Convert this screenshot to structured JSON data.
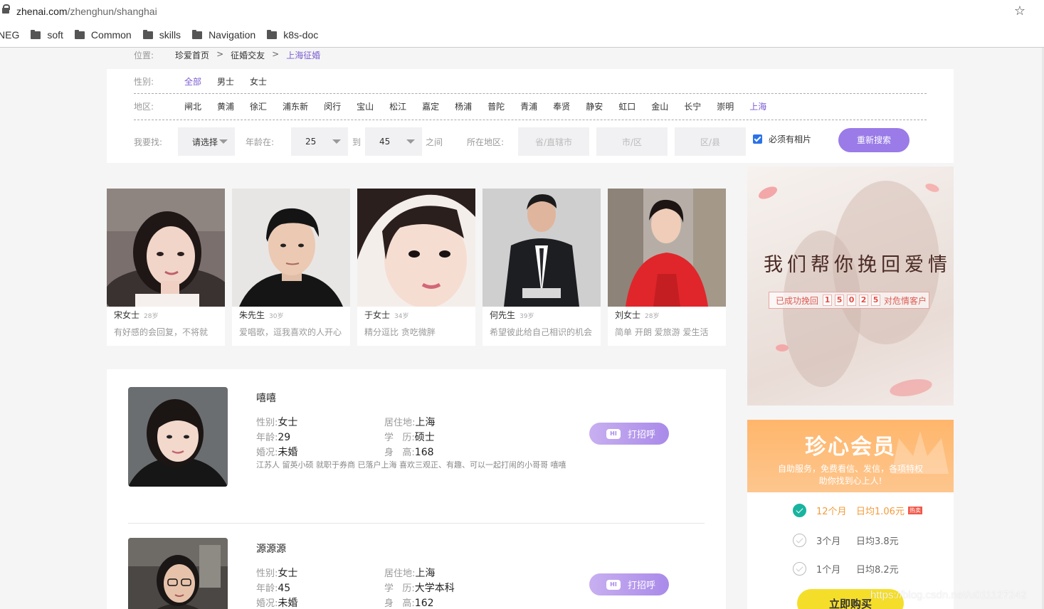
{
  "browser": {
    "url_domain": "zhenai.com",
    "url_path": "/zhenghun/shanghai",
    "bookmarks": [
      "NEG",
      "soft",
      "Common",
      "skills",
      "Navigation",
      "k8s-doc"
    ]
  },
  "breadcrumb": {
    "label": "位置:",
    "items": [
      "珍爱首页",
      ">",
      "征婚交友",
      ">",
      "上海征婚"
    ]
  },
  "filter": {
    "gender_label": "性别:",
    "gender_options": [
      "全部",
      "男士",
      "女士"
    ],
    "region_label": "地区:",
    "region_options": [
      "闸北",
      "黄浦",
      "徐汇",
      "浦东新",
      "闵行",
      "宝山",
      "松江",
      "嘉定",
      "杨浦",
      "普陀",
      "青浦",
      "奉贤",
      "静安",
      "虹口",
      "金山",
      "长宁",
      "崇明",
      "上海"
    ],
    "seek_label": "我要找:",
    "seek_value": "请选择",
    "age_label": "年龄在:",
    "age_from": "25",
    "age_to_label": "到",
    "age_to": "45",
    "age_between": "之间",
    "location_label": "所在地区:",
    "province_placeholder": "省/直辖市",
    "city_placeholder": "市/区",
    "district_placeholder": "区/县",
    "photo_required_label": "必须有相片",
    "search_button": "重新搜索"
  },
  "recommended": [
    {
      "name": "宋女士",
      "age": "28岁",
      "desc": "有好感的会回复，不将就"
    },
    {
      "name": "朱先生",
      "age": "30岁",
      "desc": "爱唱歌，逗我喜欢的人开心"
    },
    {
      "name": "于女士",
      "age": "34岁",
      "desc": "精分逗比 贪吃微胖"
    },
    {
      "name": "何先生",
      "age": "39岁",
      "desc": "希望彼此给自己相识的机会"
    },
    {
      "name": "刘女士",
      "age": "28岁",
      "desc": "简单 开朗 爱旅游 爱生活"
    }
  ],
  "banner": {
    "title": "我们帮你挽回爱情",
    "counter_prefix": "已成功挽回",
    "digits": [
      "1",
      "5",
      "0",
      "2",
      "5"
    ],
    "counter_suffix": "对危情客户"
  },
  "vip": {
    "title": "珍心会员",
    "subtitle_line1": "自助服务，免费看信、发信，各项特权",
    "subtitle_line2": "助你找到心上人!",
    "plans": [
      {
        "duration": "12个月",
        "price": "日均1.06元",
        "badge": "热卖",
        "selected": true
      },
      {
        "duration": "3个月",
        "price": "日均3.8元",
        "badge": "",
        "selected": false
      },
      {
        "duration": "1个月",
        "price": "日均8.2元",
        "badge": "",
        "selected": false
      }
    ],
    "buy_button": "立即购买"
  },
  "members": [
    {
      "name": "嘻嘻",
      "gender_k": "性别:",
      "gender": "女士",
      "age_k": "年龄:",
      "age": "29",
      "marriage_k": "婚况:",
      "marriage": "未婚",
      "residence_k": "居住地:",
      "residence": "上海",
      "education_k": "学   历:",
      "education": "硕士",
      "height_k": "身   高:",
      "height": "168",
      "bio": "江苏人 留英小硕 就职于券商 已落户上海 喜欢三观正、有趣、可以一起打闹的小哥哥 嘻嘻",
      "hi_button": "打招呼"
    },
    {
      "name": "源源源",
      "gender_k": "性别:",
      "gender": "女士",
      "age_k": "年龄:",
      "age": "45",
      "marriage_k": "婚况:",
      "marriage": "未婚",
      "residence_k": "居住地:",
      "residence": "上海",
      "education_k": "学   历:",
      "education": "大学本科",
      "height_k": "身   高:",
      "height": "162",
      "bio": "",
      "hi_button": "打招呼"
    }
  ],
  "watermark": "https://blog.csdn.net/u011127242",
  "colors": {
    "accent": "#7b5dd1",
    "button": "#9a7be8",
    "vip_orange": "#ffb66b",
    "buy_yellow": "#f5de29"
  }
}
